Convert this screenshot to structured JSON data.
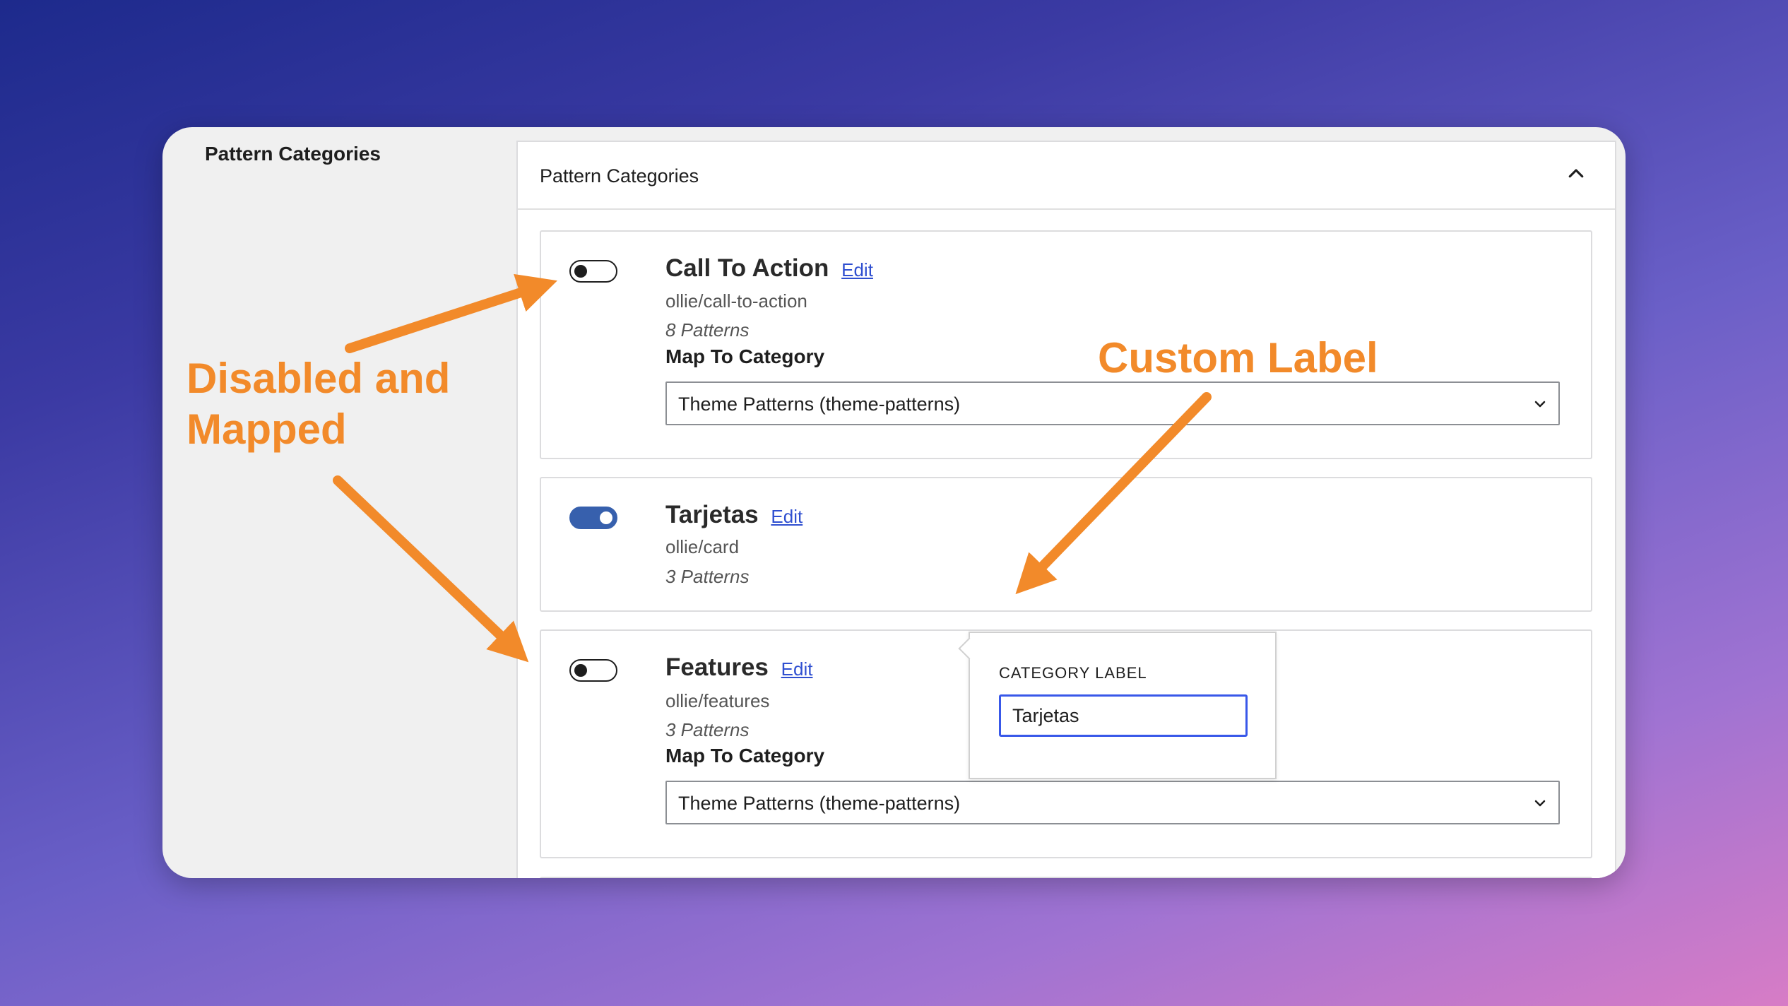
{
  "sidebar": {
    "title": "Pattern Categories"
  },
  "panel": {
    "title": "Pattern Categories"
  },
  "categories": [
    {
      "name": "Call To Action",
      "edit_label": "Edit",
      "slug": "ollie/call-to-action",
      "count": "8 Patterns",
      "enabled": false,
      "map_label": "Map To Category",
      "map_value": "Theme Patterns (theme-patterns)"
    },
    {
      "name": "Tarjetas",
      "edit_label": "Edit",
      "slug": "ollie/card",
      "count": "3 Patterns",
      "enabled": true
    },
    {
      "name": "Features",
      "edit_label": "Edit",
      "slug": "ollie/features",
      "count": "3 Patterns",
      "enabled": false,
      "map_label": "Map To Category",
      "map_value": "Theme Patterns (theme-patterns)"
    }
  ],
  "popover": {
    "label": "CATEGORY LABEL",
    "value": "Tarjetas"
  },
  "annotations": {
    "disabled_line1": "Disabled and",
    "disabled_line2": "Mapped",
    "custom_label": "Custom Label",
    "color": "#f28a2a"
  },
  "colors": {
    "toggle_on": "#3760ad",
    "link": "#2f4fd0",
    "input_focus": "#3858e9"
  }
}
